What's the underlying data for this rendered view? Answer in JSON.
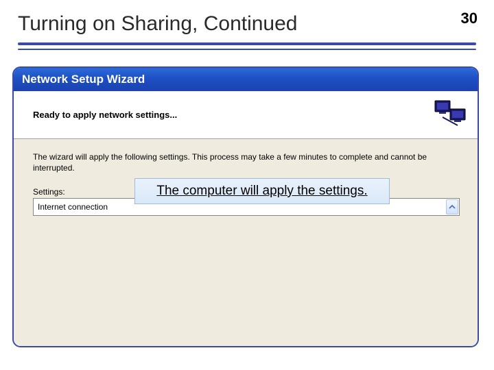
{
  "slide": {
    "title": "Turning on Sharing, Continued",
    "page_number": "30"
  },
  "wizard": {
    "titlebar": "Network Setup Wizard",
    "heading": "Ready to apply network settings...",
    "body_text": "The wizard will apply the following settings. This process may take a few minutes to complete and cannot be interrupted.",
    "settings_label": "Settings:",
    "settings_item": "Internet connection"
  },
  "callout": {
    "text": "The computer will apply the settings."
  }
}
